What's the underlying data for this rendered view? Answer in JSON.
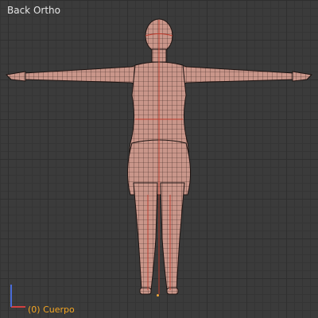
{
  "viewport": {
    "view_name": "Back Ortho",
    "object_label": "(0) Cuerpo",
    "label_color": "#f5a623"
  },
  "axes_widget": {
    "x_color": "#d24040",
    "z_color": "#4a6cd8"
  },
  "model": {
    "skin_color": "#c9968a",
    "wire_color": "#2a1c18",
    "seam_color": "#c0392b"
  }
}
